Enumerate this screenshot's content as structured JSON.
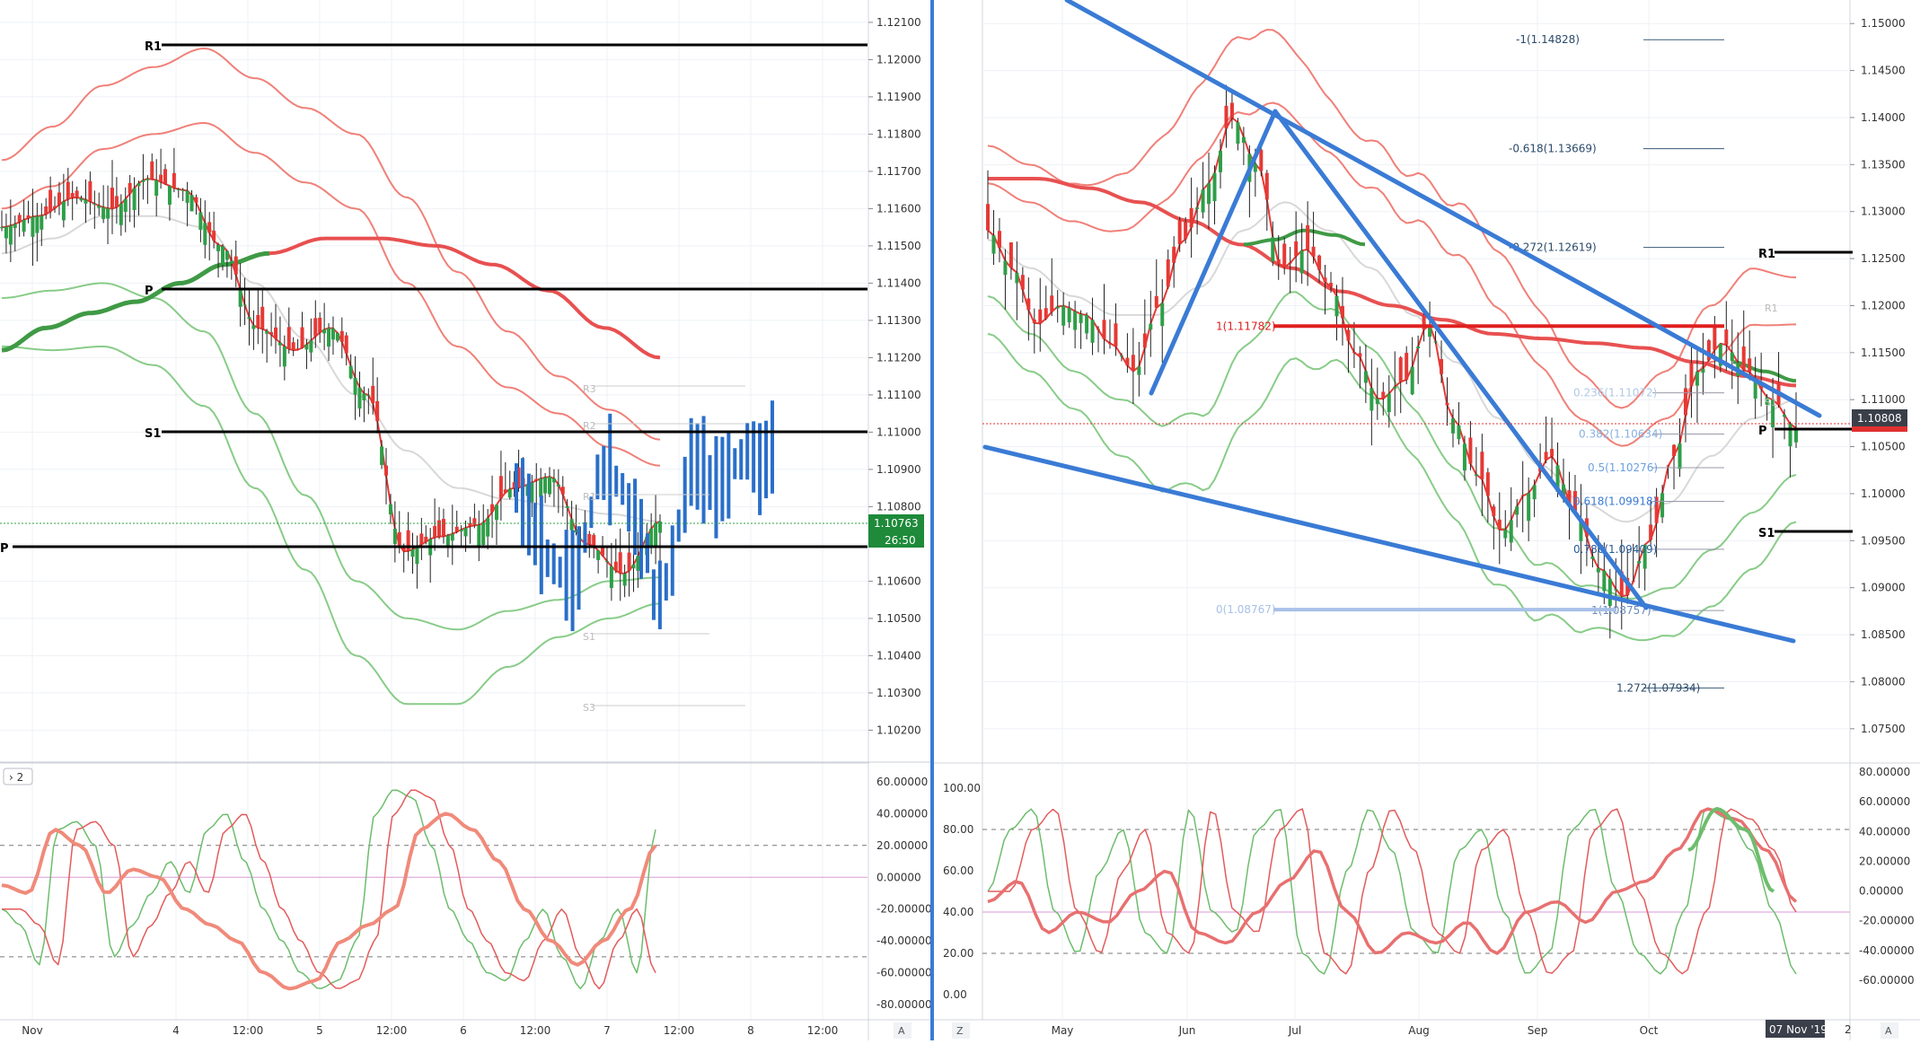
{
  "charts": {
    "left": {
      "price_ticks": [
        "1.12100",
        "1.12000",
        "1.11900",
        "1.11800",
        "1.11700",
        "1.11600",
        "1.11500",
        "1.11400",
        "1.11300",
        "1.11200",
        "1.11100",
        "1.11000",
        "1.10900",
        "1.10800",
        "1.10700",
        "1.10600",
        "1.10500",
        "1.10400",
        "1.10300",
        "1.10200"
      ],
      "time_ticks": [
        "Nov",
        "4",
        "12:00",
        "5",
        "12:00",
        "6",
        "12:00",
        "7",
        "12:00",
        "8",
        "12:00"
      ],
      "osc_ticks": [
        "60.00000",
        "40.00000",
        "20.00000",
        "0.00000",
        "-20.00000",
        "-40.00000",
        "-60.00000",
        "-80.00000"
      ],
      "last_price": "1.10763",
      "countdown": "26:50",
      "pane_tab": "› 2",
      "axis_btn": "A",
      "pivot_labels": [
        "R1",
        "P",
        "S1",
        "P"
      ],
      "faint_labels": [
        "R3",
        "R2",
        "R1",
        "S1",
        "S3"
      ]
    },
    "right": {
      "price_ticks": [
        "1.15000",
        "1.14500",
        "1.14000",
        "1.13500",
        "1.13000",
        "1.12500",
        "1.12000",
        "1.11500",
        "1.11000",
        "1.10500",
        "1.10000",
        "1.09500",
        "1.09000",
        "1.08500",
        "1.08000",
        "1.07500"
      ],
      "time_ticks": [
        "May",
        "Jun",
        "Jul",
        "Aug",
        "Sep",
        "Oct"
      ],
      "osc_left_ticks": [
        "100.00",
        "80.00",
        "60.00",
        "40.00",
        "20.00",
        "0.00"
      ],
      "osc_right_ticks": [
        "80.00000",
        "60.00000",
        "40.00000",
        "20.00000",
        "0.00000",
        "-20.00000",
        "-40.00000",
        "-60.00000"
      ],
      "last_price": "1.10808",
      "date_badge": "07 Nov '19",
      "axis_after_date": "2",
      "z_btn": "Z",
      "axis_btn": "A",
      "pivot_labels": [
        "R1",
        "P",
        "S1"
      ],
      "faint_labels": [
        "R1",
        "S1"
      ],
      "fib_ext_labels": [
        "-1(1.14828)",
        "-0.618(1.13669)",
        "-0.272(1.12619)",
        "1.272(1.07934)"
      ],
      "fib_ret_labels": [
        "1(1.11782)",
        "0.236(1.11072)",
        "0.382(1.10634)",
        "0.5(1.10276)",
        "0.618(1.09918)",
        "0.786(1.09409)",
        "1(1.08757)",
        "0(1.08767)"
      ]
    }
  },
  "chart_data": [
    {
      "type": "line",
      "title": "",
      "instrument_note": "intraday candlestick chart with Bollinger bands, moving averages, pivot levels and stochastic oscillator",
      "y_axis_range": [
        1.1016,
        1.1216
      ],
      "x_range": [
        "Nov 1",
        "Nov 8 12:00"
      ],
      "pivot_levels": {
        "R1": 1.1202,
        "P": 1.1138,
        "S1": 1.11,
        "P_current": 1.107
      },
      "last_price": 1.10763,
      "series": [
        {
          "name": "",
          "kind": "close",
          "x": [
            "Nov 1",
            "Nov 4 06:00",
            "Nov 4 12:00",
            "Nov 5 00:00",
            "Nov 5 12:00",
            "Nov 6 00:00",
            "Nov 6 12:00",
            "Nov 7 00:00",
            "Nov 7 09:00"
          ],
          "values": [
            1.1155,
            1.1163,
            1.1168,
            1.115,
            1.1128,
            1.1068,
            1.1085,
            1.1062,
            1.1076
          ]
        }
      ],
      "oscillator": {
        "ylim": [
          -80,
          60
        ],
        "overbought": 20,
        "oversold": -50
      }
    },
    {
      "type": "line",
      "title": "",
      "instrument_note": "daily candlestick chart with Bollinger bands, moving averages, wedge trendlines, fibonacci levels and stochastic oscillator",
      "y_axis_range": [
        1.0725,
        1.1525
      ],
      "x_range": [
        "Apr",
        "Nov 2"
      ],
      "pivot_levels": {
        "R1": 1.1262,
        "P": 1.1077,
        "S1": 1.0962
      },
      "last_price": 1.10808,
      "fibonacci": {
        "levels": [
          -1,
          -0.618,
          -0.272,
          0,
          0.236,
          0.382,
          0.5,
          0.618,
          0.786,
          1,
          1.272
        ],
        "prices": [
          1.14828,
          1.13669,
          1.12619,
          1.08767,
          1.11072,
          1.10634,
          1.10276,
          1.09918,
          1.09409,
          1.08757,
          1.07934
        ]
      },
      "series": [
        {
          "name": "",
          "kind": "close",
          "x": [
            "Apr",
            "May",
            "Jun",
            "Jun 25",
            "Jul",
            "Aug",
            "Sep",
            "Oct 1",
            "Oct 20",
            "Nov 7"
          ],
          "values": [
            1.128,
            1.118,
            1.121,
            1.14,
            1.126,
            1.109,
            1.098,
            1.089,
            1.116,
            1.1081
          ]
        }
      ],
      "oscillator": {
        "ylim_left": [
          0,
          100
        ],
        "ylim_right": [
          -60,
          80
        ]
      }
    }
  ]
}
